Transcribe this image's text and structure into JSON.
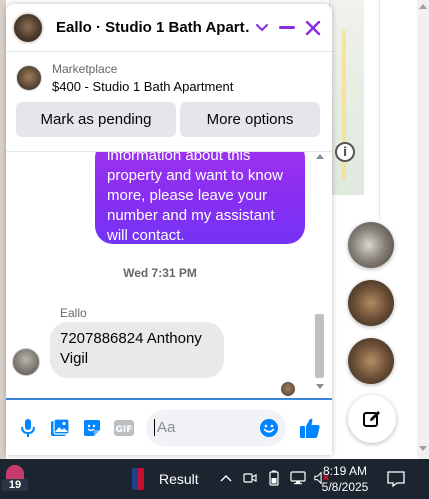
{
  "chat": {
    "title": "Eallo · Studio 1 Bath Apart…",
    "listing": {
      "kicker": "Marketplace",
      "line": "$400 - Studio 1 Bath Apartment",
      "mark_pending_label": "Mark as pending",
      "more_options_label": "More options"
    },
    "messages": {
      "outgoing_text": "information about this\nproperty and want to know\nmore, please leave your\nnumber and my assistant\nwill contact.",
      "timestamp": "Wed 7:31 PM",
      "sender_name": "Eallo",
      "incoming_text": "7207886824 Anthony Vigil"
    },
    "composer": {
      "placeholder": "Aa"
    }
  },
  "taskbar": {
    "badge_count": "19",
    "news_label": "Result",
    "time": "8:19 AM",
    "date": "5/8/2025"
  },
  "colors": {
    "accent_purple": "#a233f0",
    "messenger_blue": "#0084ff",
    "header_icon_purple": "#8a2be2"
  },
  "icons": {
    "header": [
      "chevron-down-icon",
      "minimize-icon",
      "close-icon"
    ],
    "composer": [
      "microphone-icon",
      "photo-icon",
      "sticker-icon",
      "gif-icon",
      "emoji-icon",
      "thumbs-up-icon"
    ],
    "map": [
      "info-icon"
    ],
    "floating": [
      "compose-new-message-icon"
    ],
    "tray": [
      "chevron-up-icon",
      "meet-now-icon",
      "battery-icon",
      "network-icon",
      "volume-muted-icon",
      "notification-icon"
    ]
  }
}
